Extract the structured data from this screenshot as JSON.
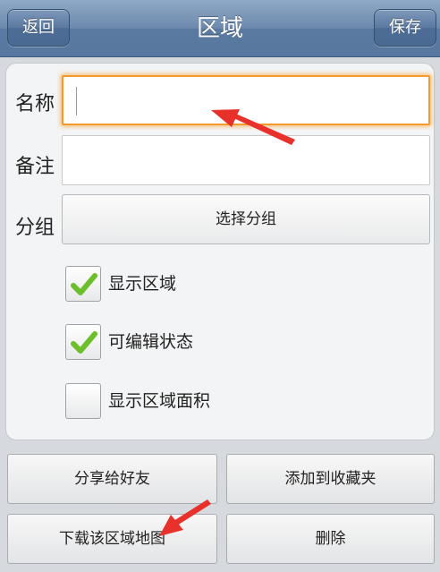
{
  "navbar": {
    "title": "区域",
    "back_label": "返回",
    "save_label": "保存"
  },
  "form": {
    "name_label": "名称",
    "name_value": "",
    "note_label": "备注",
    "note_value": "",
    "group_label": "分组",
    "group_button": "选择分组"
  },
  "options": [
    {
      "label": "显示区域",
      "checked": true
    },
    {
      "label": "可编辑状态",
      "checked": true
    },
    {
      "label": "显示区域面积",
      "checked": false
    }
  ],
  "actions": {
    "share": "分享给好友",
    "favorite": "添加到收藏夹",
    "download": "下载该区域地图",
    "delete": "删除"
  },
  "colors": {
    "navbar": "#6c89ad",
    "focus_border": "#f29b2c",
    "check_green": "#6cbf2a",
    "annotation_arrow": "#e8312a"
  }
}
